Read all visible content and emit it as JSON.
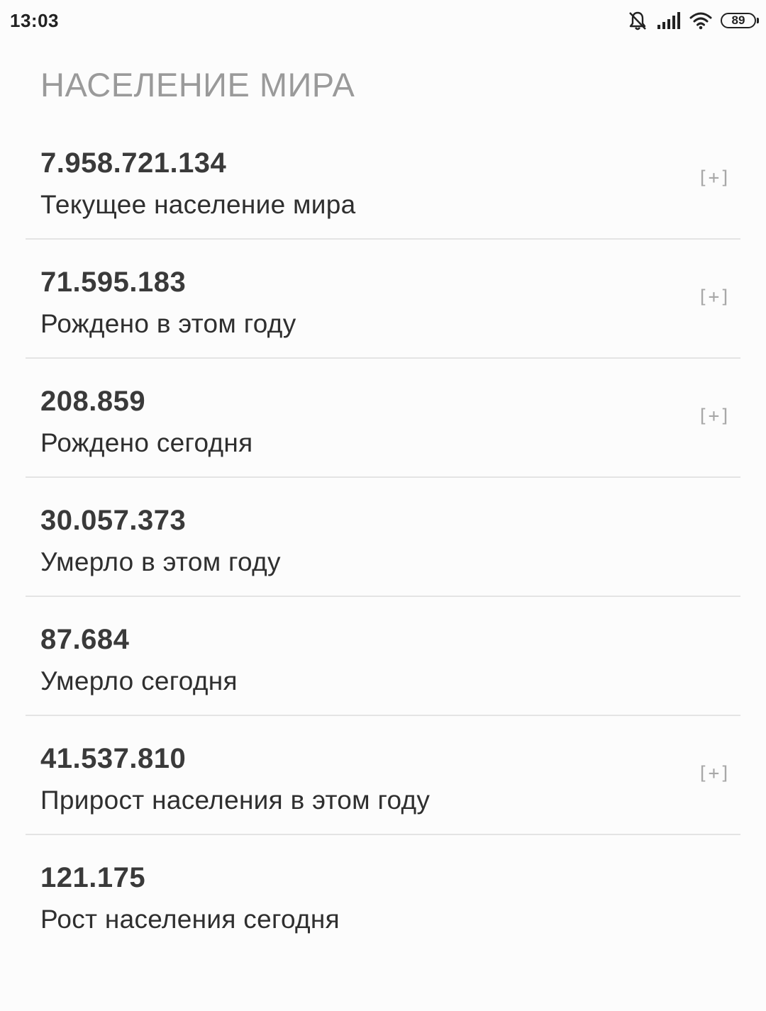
{
  "status_bar": {
    "time": "13:03",
    "battery_level": "89",
    "icons": [
      "bell-muted-icon",
      "cellular-signal-icon",
      "wifi-icon",
      "battery-icon"
    ]
  },
  "page": {
    "title": "НАСЕЛЕНИЕ МИРА"
  },
  "stats": [
    {
      "value": "7.958.721.134",
      "label": "Текущее население мира",
      "expand": "[+]"
    },
    {
      "value": "71.595.183",
      "label": "Рождено в этом году",
      "expand": "[+]"
    },
    {
      "value": "208.859",
      "label": "Рождено сегодня",
      "expand": "[+]"
    },
    {
      "value": "30.057.373",
      "label": "Умерло в этом году"
    },
    {
      "value": "87.684",
      "label": "Умерло сегодня"
    },
    {
      "value": "41.537.810",
      "label": "Прирост населения в этом году",
      "expand": "[+]"
    },
    {
      "value": "121.175",
      "label": "Рост населения сегодня"
    }
  ],
  "colors": {
    "background": "#fcfcfc",
    "title": "#9a9a9a",
    "value": "#3a3a3a",
    "divider": "#e4e4e4",
    "expand": "#a8a8a8"
  }
}
